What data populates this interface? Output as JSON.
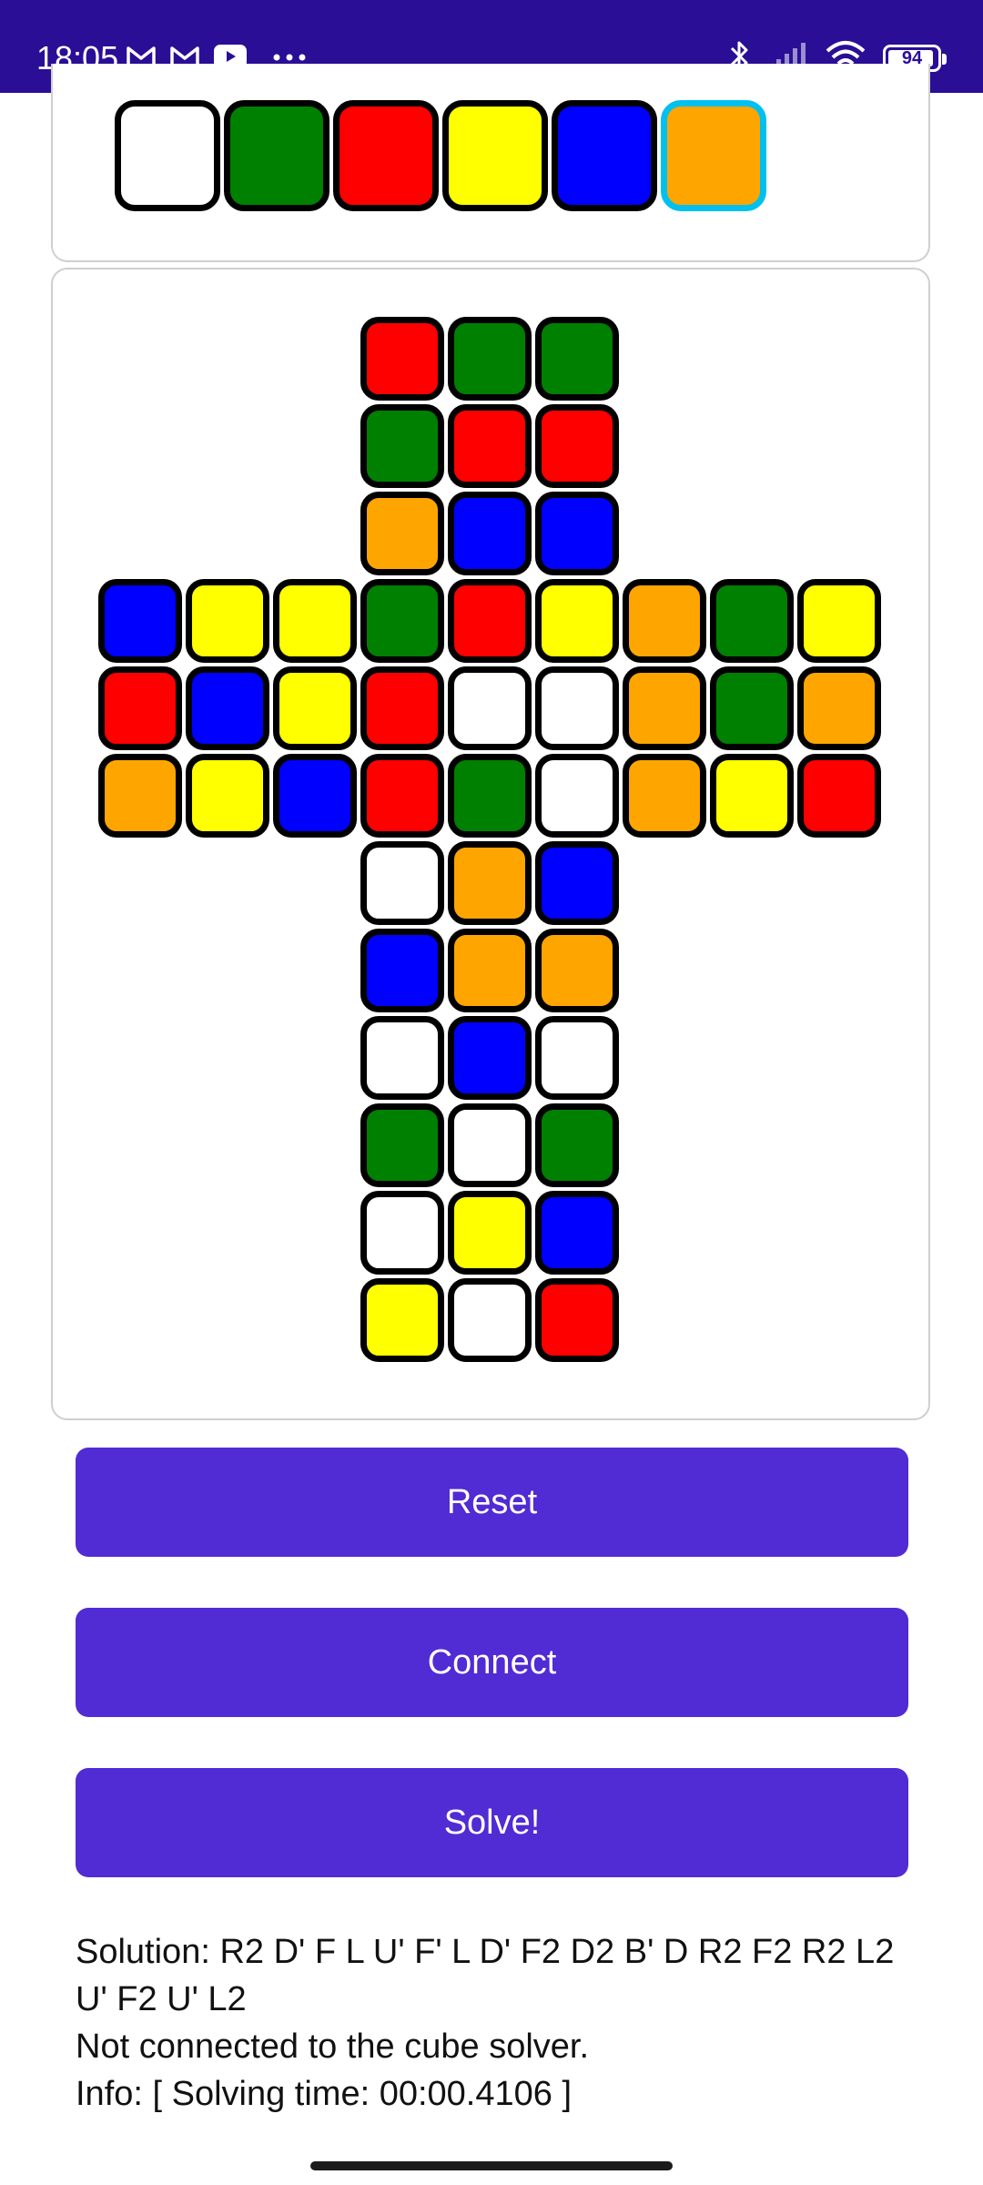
{
  "status_bar": {
    "time": "18:05",
    "battery": "94",
    "battery_level": 0.94,
    "background": "#2a0e96",
    "left_icons": [
      "gmail-icon",
      "gmail-icon",
      "youtube-icon",
      "more-dots-icon"
    ],
    "right_icons": [
      "bluetooth-icon",
      "signal-icon",
      "wifi-icon",
      "battery-icon"
    ]
  },
  "colors": {
    "white": "#ffffff",
    "green": "#008000",
    "red": "#ff0000",
    "yellow": "#ffff00",
    "blue": "#0000ff",
    "orange": "#ffa500",
    "selected_border": "#00c0f0",
    "button": "#512bd4"
  },
  "palette": {
    "swatches": [
      "white",
      "green",
      "red",
      "yellow",
      "blue",
      "orange"
    ],
    "selected": "orange"
  },
  "cube": {
    "up": [
      [
        "red",
        "green",
        "green"
      ],
      [
        "green",
        "red",
        "red"
      ],
      [
        "orange",
        "blue",
        "blue"
      ]
    ],
    "left": [
      [
        "blue",
        "yellow",
        "yellow"
      ],
      [
        "red",
        "blue",
        "yellow"
      ],
      [
        "orange",
        "yellow",
        "blue"
      ]
    ],
    "front": [
      [
        "green",
        "red",
        "yellow"
      ],
      [
        "red",
        "white",
        "white"
      ],
      [
        "red",
        "green",
        "white"
      ]
    ],
    "right": [
      [
        "orange",
        "green",
        "yellow"
      ],
      [
        "orange",
        "green",
        "orange"
      ],
      [
        "orange",
        "yellow",
        "red"
      ]
    ],
    "down": [
      [
        "white",
        "orange",
        "blue"
      ],
      [
        "blue",
        "orange",
        "orange"
      ],
      [
        "white",
        "blue",
        "white"
      ]
    ],
    "back": [
      [
        "green",
        "white",
        "green"
      ],
      [
        "white",
        "yellow",
        "blue"
      ],
      [
        "yellow",
        "white",
        "red"
      ]
    ]
  },
  "buttons": {
    "reset": "Reset",
    "connect": "Connect",
    "solve": "Solve!"
  },
  "output": {
    "solution": "Solution: R2 D' F L U' F' L D' F2 D2 B' D R2 F2 R2 L2 U' F2 U' L2",
    "connection": "Not connected to the cube solver.",
    "info": "Info: [ Solving time: 00:00.4106 ]"
  }
}
